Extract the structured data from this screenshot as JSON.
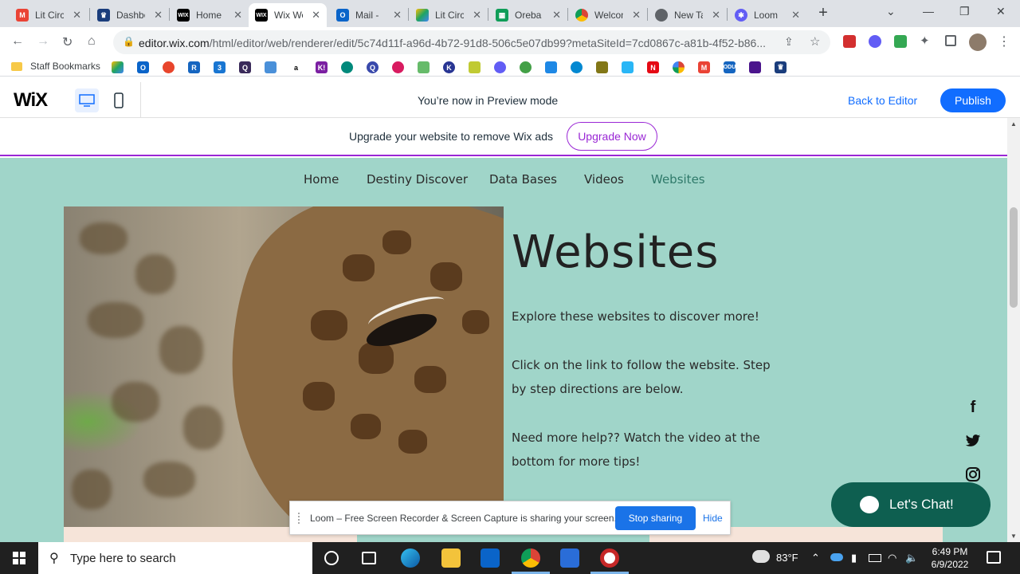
{
  "browser": {
    "tabs": [
      {
        "label": "Lit Circ",
        "favicon": "gmail-icon",
        "color": "#ea4335"
      },
      {
        "label": "Dashboard",
        "favicon": "dashboard-icon",
        "color": "#1a3d7c"
      },
      {
        "label": "Home",
        "favicon": "wix-icon",
        "color": "#000000"
      },
      {
        "label": "Wix Website",
        "favicon": "wix-icon",
        "color": "#000000"
      },
      {
        "label": "Mail -",
        "favicon": "outlook-icon",
        "color": "#0a64c9"
      },
      {
        "label": "Lit Circ",
        "favicon": "drive-icon",
        "color": "#1fa463"
      },
      {
        "label": "Oreba",
        "favicon": "sheets-icon",
        "color": "#0f9d58"
      },
      {
        "label": "Welcome",
        "favicon": "chrome-icon",
        "color": "#db4437"
      },
      {
        "label": "New Tab",
        "favicon": "chrome-icon",
        "color": "#5f6368"
      },
      {
        "label": "Loom",
        "favicon": "loom-icon",
        "color": "#625df5"
      }
    ],
    "url_host": "editor.wix.com",
    "url_path": "/html/editor/web/renderer/edit/5c74d11f-a96d-4b72-91d8-506c5e07db99?metaSiteId=7cd0867c-a81b-4f52-b86...",
    "bookmarks_folder": "Staff Bookmarks"
  },
  "wix_bar": {
    "logo": "WiX",
    "preview_text": "You’re now in Preview mode",
    "back_label": "Back to Editor",
    "publish_label": "Publish"
  },
  "upgrade_banner": {
    "text": "Upgrade your website to remove Wix ads",
    "button_label": "Upgrade Now"
  },
  "site": {
    "nav": [
      "Home",
      "Destiny Discover",
      "Data Bases",
      "Videos",
      "Websites"
    ],
    "current_page": "Websites",
    "title": "Websites",
    "paragraphs": [
      "Explore these websites to discover more!",
      "Click on the link to follow the website.  Step by step directions are below.",
      "Need more help??  Watch the video at the bottom for more tips!"
    ],
    "social": [
      "f",
      "twitter",
      "instagram"
    ],
    "chat_label": "Let's Chat!"
  },
  "loom_bar": {
    "message": "Loom – Free Screen Recorder & Screen Capture is sharing your screen.",
    "stop_label": "Stop sharing",
    "hide_label": "Hide"
  },
  "taskbar": {
    "search_placeholder": "Type here to search",
    "weather": "83°F",
    "time": "6:49 PM",
    "date": "6/9/2022"
  }
}
